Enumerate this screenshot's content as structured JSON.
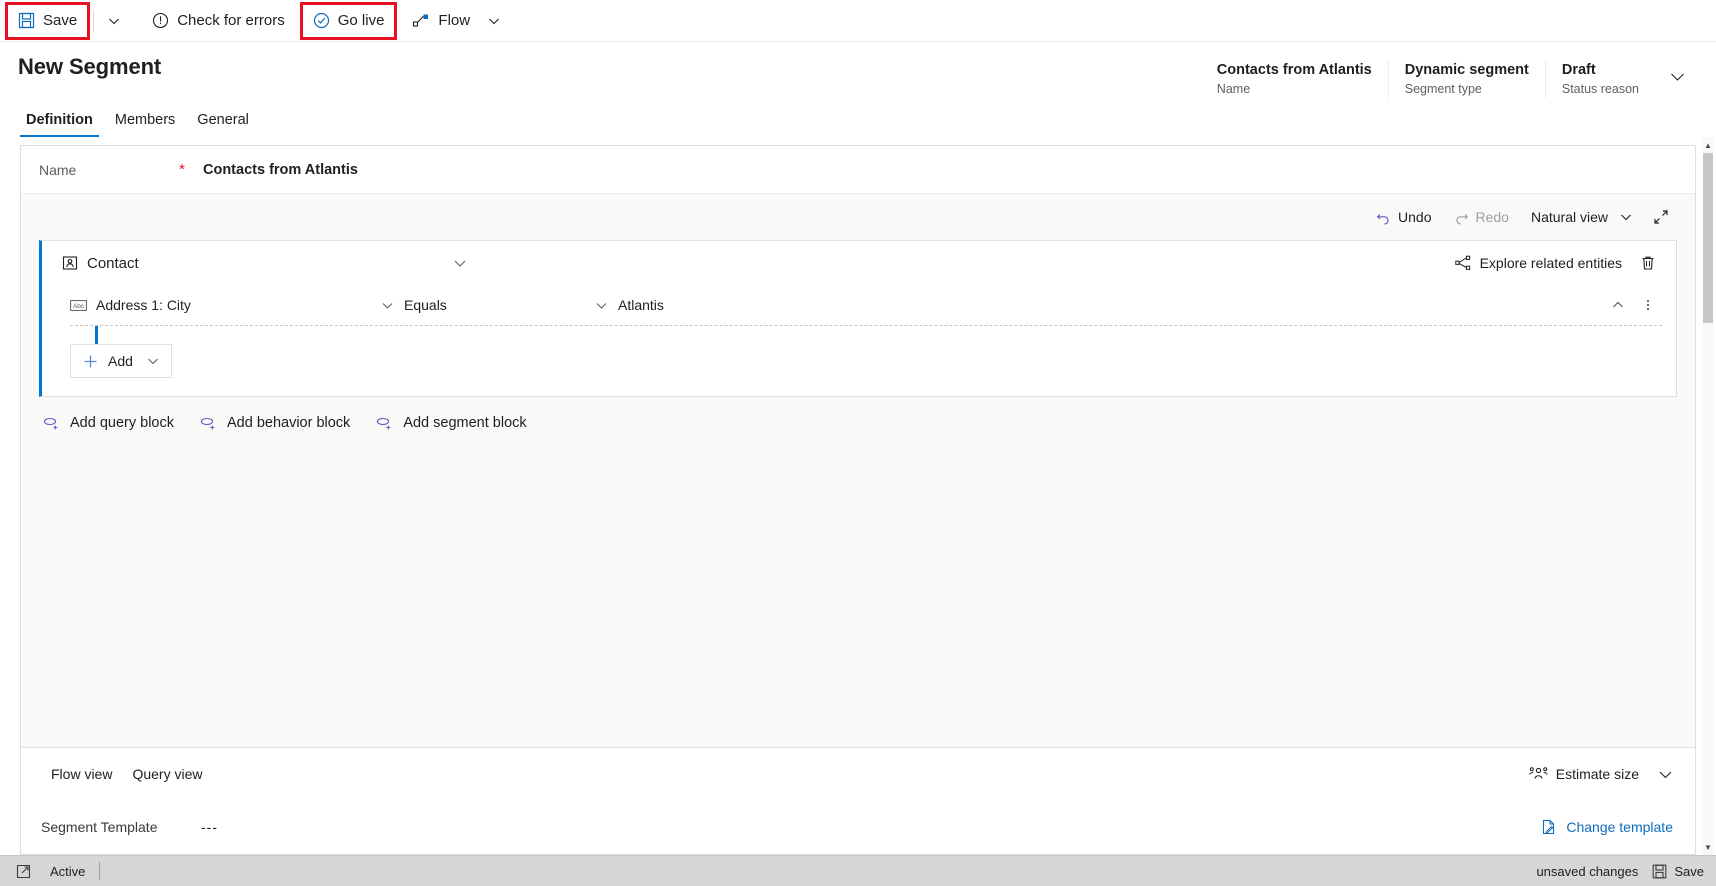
{
  "command_bar": {
    "save_label": "Save",
    "save_caret_icon": "chevron-down-icon",
    "check_errors_label": "Check for errors",
    "check_errors_icon": "exclamation-circle-icon",
    "go_live_label": "Go live",
    "go_live_icon": "check-circle-icon",
    "flow_label": "Flow",
    "flow_icon": "flow-icon",
    "flow_caret_icon": "chevron-down-icon",
    "highlight_color": "#e81123"
  },
  "header": {
    "title": "New Segment",
    "meta": [
      {
        "value": "Contacts from Atlantis",
        "label": "Name"
      },
      {
        "value": "Dynamic segment",
        "label": "Segment type"
      },
      {
        "value": "Draft",
        "label": "Status reason"
      }
    ],
    "expand_icon": "chevron-down-icon"
  },
  "tabs": [
    {
      "label": "Definition",
      "active": true
    },
    {
      "label": "Members",
      "active": false
    },
    {
      "label": "General",
      "active": false
    }
  ],
  "form": {
    "name_label": "Name",
    "required_marker": "*",
    "name_value": "Contacts from Atlantis"
  },
  "builder_toolbar": {
    "undo_label": "Undo",
    "undo_icon": "undo-icon",
    "redo_label": "Redo",
    "redo_icon": "redo-icon",
    "view_label": "Natural view",
    "view_caret_icon": "chevron-down-icon",
    "expand_icon": "expand-diagonal-icon"
  },
  "query_block": {
    "entity_icon": "contact-icon",
    "entity_name": "Contact",
    "collapse_icon": "chevron-down-icon",
    "explore_label": "Explore related entities",
    "explore_icon": "share-nodes-icon",
    "delete_icon": "trash-icon",
    "condition": {
      "field_icon": "abc-text-icon",
      "field": "Address 1: City",
      "field_caret_icon": "chevron-down-icon",
      "operator": "Equals",
      "operator_caret_icon": "chevron-down-icon",
      "value": "Atlantis",
      "collapse_icon": "chevron-up-icon",
      "more_icon": "more-vertical-icon"
    },
    "add_label": "Add",
    "add_icon": "plus-icon",
    "add_caret_icon": "chevron-down-icon",
    "accent_color": "#0078d4"
  },
  "add_blocks": [
    {
      "label": "Add query block",
      "icon": "add-query-icon"
    },
    {
      "label": "Add behavior block",
      "icon": "add-behavior-icon"
    },
    {
      "label": "Add segment block",
      "icon": "add-segment-icon"
    }
  ],
  "bottom_panel": {
    "views": [
      {
        "label": "Flow view"
      },
      {
        "label": "Query view"
      }
    ],
    "estimate_label": "Estimate size",
    "estimate_icon": "people-icon",
    "estimate_caret_icon": "chevron-down-icon",
    "template_label": "Segment Template",
    "template_value": "---",
    "change_template_label": "Change template",
    "change_template_icon": "document-edit-icon",
    "link_color": "#0f6cbd"
  },
  "status_bar": {
    "expand_icon": "popout-icon",
    "state": "Active",
    "unsaved": "unsaved changes",
    "save_label": "Save",
    "save_icon": "save-icon"
  }
}
